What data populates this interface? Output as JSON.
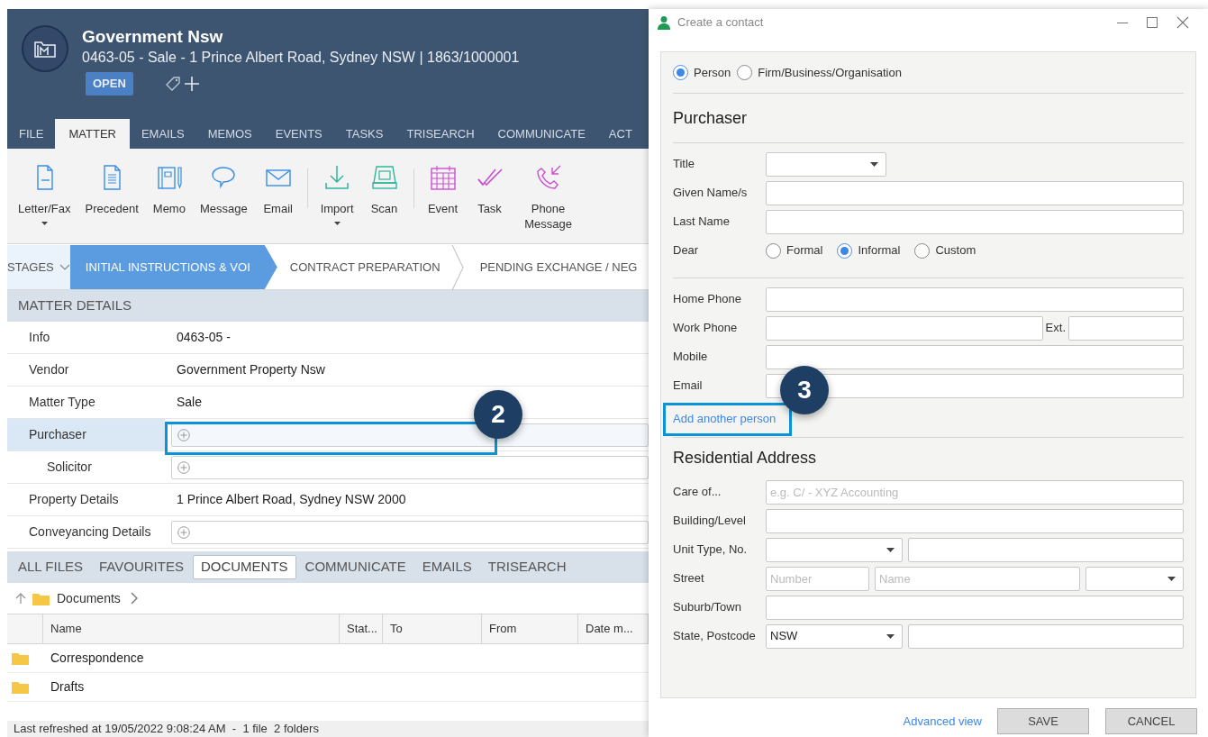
{
  "matter": {
    "client": "Government Nsw",
    "subtitle": "0463-05 - Sale - 1 Prince Albert Road, Sydney NSW | 1863/1000001",
    "status": "OPEN"
  },
  "ribbon_tabs": [
    {
      "label": "FILE",
      "selected": false
    },
    {
      "label": "MATTER",
      "selected": true
    },
    {
      "label": "EMAILS",
      "selected": false
    },
    {
      "label": "MEMOS",
      "selected": false
    },
    {
      "label": "EVENTS",
      "selected": false
    },
    {
      "label": "TASKS",
      "selected": false
    },
    {
      "label": "TRISEARCH",
      "selected": false
    },
    {
      "label": "COMMUNICATE",
      "selected": false
    },
    {
      "label": "ACT",
      "selected": false
    }
  ],
  "toolbar_groups": [
    [
      {
        "label": "Letter/Fax",
        "kind": "letter",
        "dropdown": true
      },
      {
        "label": "Precedent",
        "kind": "precedent",
        "dropdown": false
      },
      {
        "label": "Memo",
        "kind": "memo",
        "dropdown": false
      },
      {
        "label": "Message",
        "kind": "message",
        "dropdown": false
      },
      {
        "label": "Email",
        "kind": "email",
        "dropdown": false
      }
    ],
    [
      {
        "label": "Import",
        "kind": "import",
        "dropdown": true
      },
      {
        "label": "Scan",
        "kind": "scan",
        "dropdown": false
      }
    ],
    [
      {
        "label": "Event",
        "kind": "event",
        "dropdown": false
      },
      {
        "label": "Task",
        "kind": "task",
        "dropdown": false
      },
      {
        "label": "Phone Message",
        "kind": "phone",
        "dropdown": false
      }
    ]
  ],
  "stages": {
    "label": "STAGES",
    "items": [
      {
        "label": "INITIAL INSTRUCTIONS & VOI",
        "selected": true
      },
      {
        "label": "CONTRACT PREPARATION",
        "selected": false
      },
      {
        "label": "PENDING EXCHANGE / NEG",
        "selected": false
      }
    ]
  },
  "matter_details": {
    "title": "MATTER DETAILS",
    "rows": [
      {
        "label": "Info",
        "kind": "text",
        "value": "0463-05 -",
        "selected": false
      },
      {
        "label": "Vendor",
        "kind": "text",
        "value": "Government Property Nsw",
        "selected": false
      },
      {
        "label": "Matter Type",
        "kind": "text",
        "value": "Sale",
        "selected": false
      },
      {
        "label": "Purchaser",
        "kind": "add",
        "selected": true,
        "children": [
          {
            "label": "Solicitor",
            "kind": "add",
            "selected": false
          }
        ]
      },
      {
        "label": "Property Details",
        "kind": "text",
        "value": "1 Prince Albert Road, Sydney NSW 2000",
        "selected": false
      },
      {
        "label": "Conveyancing Details",
        "kind": "add",
        "selected": false
      }
    ]
  },
  "file_tabs": [
    {
      "label": "ALL FILES",
      "selected": false
    },
    {
      "label": "FAVOURITES",
      "selected": false
    },
    {
      "label": "DOCUMENTS",
      "selected": true
    },
    {
      "label": "COMMUNICATE",
      "selected": false
    },
    {
      "label": "EMAILS",
      "selected": false
    },
    {
      "label": "TRISEARCH",
      "selected": false
    }
  ],
  "breadcrumb": "Documents",
  "table": {
    "columns": [
      "Name",
      "Stat...",
      "To",
      "From",
      "Date m..."
    ],
    "rows": [
      {
        "name": "Correspondence",
        "kind": "folder"
      },
      {
        "name": "Drafts",
        "kind": "folder"
      }
    ]
  },
  "status_bar": "Last refreshed at 19/05/2022 9:08:24 AM  -  1 file  2 folders",
  "dialog": {
    "title": "Create a contact",
    "contact_types": [
      {
        "label": "Person",
        "selected": true
      },
      {
        "label": "Firm/Business/Organisation",
        "selected": false
      }
    ],
    "section_title": "Purchaser",
    "name_fields": [
      {
        "label": "Title",
        "controls": [
          {
            "kind": "select"
          }
        ]
      },
      {
        "label": "Given Name/s",
        "controls": [
          {
            "kind": "input"
          }
        ]
      },
      {
        "label": "Last Name",
        "controls": [
          {
            "kind": "input"
          }
        ]
      },
      {
        "label": "Dear",
        "controls": [
          {
            "kind": "radio",
            "label": "Formal",
            "selected": false
          },
          {
            "kind": "radio",
            "label": "Informal",
            "selected": true
          },
          {
            "kind": "radio",
            "label": "Custom",
            "selected": false
          }
        ]
      }
    ],
    "contact_fields": [
      {
        "label": "Home Phone",
        "controls": [
          {
            "kind": "input"
          }
        ]
      },
      {
        "label": "Work Phone",
        "controls": [
          {
            "kind": "input"
          },
          {
            "kind": "label",
            "label": "Ext."
          },
          {
            "kind": "input"
          }
        ]
      },
      {
        "label": "Mobile",
        "controls": [
          {
            "kind": "input"
          }
        ]
      },
      {
        "label": "Email",
        "controls": [
          {
            "kind": "input"
          }
        ]
      }
    ],
    "add_link": "Add another person",
    "address_title": "Residential Address",
    "address_fields": [
      {
        "label": "Care of...",
        "controls": [
          {
            "kind": "input",
            "placeholder": "e.g. C/ - XYZ Accounting"
          }
        ]
      },
      {
        "label": "Building/Level",
        "controls": [
          {
            "kind": "input"
          }
        ]
      },
      {
        "label": "Unit Type, No.",
        "controls": [
          {
            "kind": "select"
          },
          {
            "kind": "input"
          }
        ]
      },
      {
        "label": "Street",
        "controls": [
          {
            "kind": "input",
            "placeholder": "Number"
          },
          {
            "kind": "input",
            "placeholder": "Name"
          },
          {
            "kind": "select"
          }
        ]
      },
      {
        "label": "Suburb/Town",
        "controls": [
          {
            "kind": "input"
          }
        ]
      },
      {
        "label": "State, Postcode",
        "controls": [
          {
            "kind": "select",
            "value": "NSW"
          },
          {
            "kind": "input"
          }
        ]
      }
    ],
    "advanced_link": "Advanced view",
    "buttons": [
      "SAVE",
      "CANCEL"
    ]
  },
  "callouts": [
    {
      "number": "2"
    },
    {
      "number": "3"
    }
  ]
}
